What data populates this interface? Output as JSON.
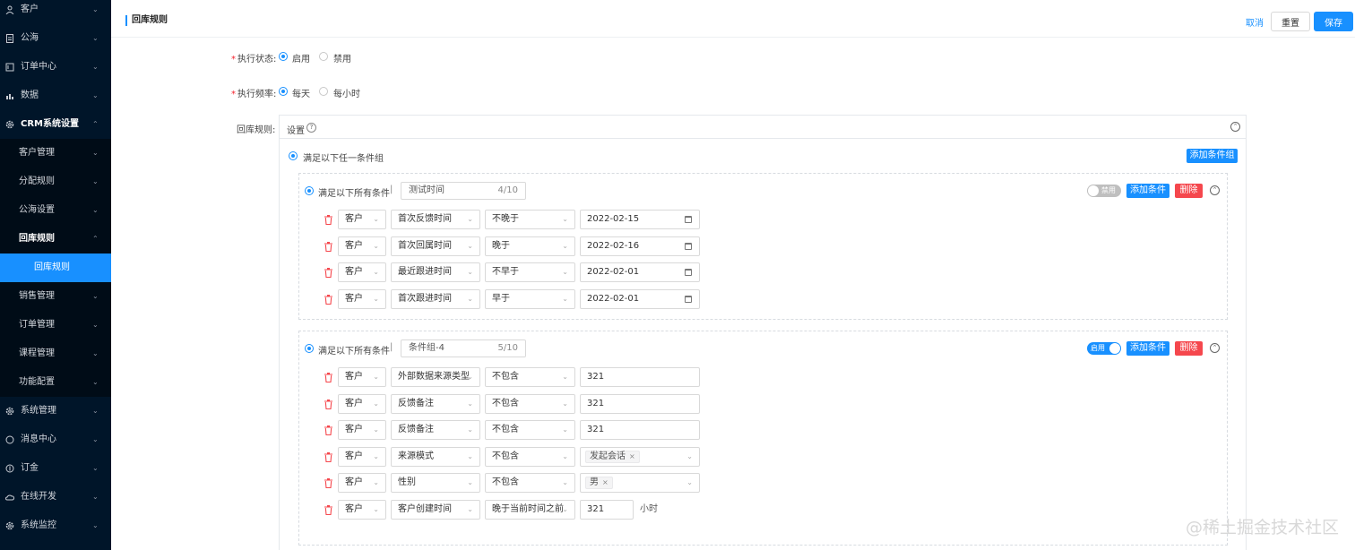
{
  "sidebar": {
    "items": [
      {
        "label": "客户",
        "icon": "user-icon",
        "chevron": "⌄",
        "type": "top"
      },
      {
        "label": "公海",
        "icon": "document-icon",
        "chevron": "⌄",
        "type": "top"
      },
      {
        "label": "订单中心",
        "icon": "receipt-icon",
        "chevron": "⌄",
        "type": "top"
      },
      {
        "label": "数据",
        "icon": "bar-chart-icon",
        "chevron": "⌄",
        "type": "top"
      },
      {
        "label": "CRM系统设置",
        "icon": "gear-icon",
        "chevron": "⌃",
        "type": "top-open"
      },
      {
        "label": "客户管理",
        "chevron": "⌄",
        "type": "sub"
      },
      {
        "label": "分配规则",
        "chevron": "⌄",
        "type": "sub"
      },
      {
        "label": "公海设置",
        "chevron": "⌄",
        "type": "sub"
      },
      {
        "label": "回库规则",
        "chevron": "⌃",
        "type": "sub-open"
      },
      {
        "label": "回库规则",
        "chevron": "",
        "type": "active"
      },
      {
        "label": "销售管理",
        "chevron": "⌄",
        "type": "sub"
      },
      {
        "label": "订单管理",
        "chevron": "⌄",
        "type": "sub"
      },
      {
        "label": "课程管理",
        "chevron": "⌄",
        "type": "sub"
      },
      {
        "label": "功能配置",
        "chevron": "⌄",
        "type": "sub"
      },
      {
        "label": "系统管理",
        "icon": "gear-icon",
        "chevron": "⌄",
        "type": "top"
      },
      {
        "label": "消息中心",
        "icon": "message-icon",
        "chevron": "⌄",
        "type": "top"
      },
      {
        "label": "订金",
        "icon": "coin-icon",
        "chevron": "⌄",
        "type": "top"
      },
      {
        "label": "在线开发",
        "icon": "cloud-icon",
        "chevron": "⌄",
        "type": "top"
      },
      {
        "label": "系统监控",
        "icon": "gear-icon",
        "chevron": "⌄",
        "type": "top"
      }
    ]
  },
  "header": {
    "title": "回库规则",
    "cancel": "取消",
    "reset": "重置",
    "save": "保存"
  },
  "form": {
    "status_label": "执行状态:",
    "status_options": [
      "启用",
      "禁用"
    ],
    "status_selected": "启用",
    "freq_label": "执行频率:",
    "freq_options": [
      "每天",
      "每小时"
    ],
    "freq_selected": "每天",
    "rule_label": "回库规则:",
    "settings_label": "设置",
    "help_icon": "?",
    "collapse_icon": "⌃",
    "any_group_label": "满足以下任一条件组",
    "add_group_button": "添加条件组"
  },
  "groups": [
    {
      "match_label": "满足以下所有条件",
      "separator": "|",
      "name": "测试时间",
      "count": "4/10",
      "toggle_text": "禁用",
      "enabled": false,
      "add_condition": "添加条件",
      "delete": "删除",
      "conditions": [
        {
          "object": "客户",
          "field": "首次反馈时间",
          "operator": "不晚于",
          "value": "2022-02-15",
          "value_type": "date"
        },
        {
          "object": "客户",
          "field": "首次回属时间",
          "operator": "晚于",
          "value": "2022-02-16",
          "value_type": "date"
        },
        {
          "object": "客户",
          "field": "最近跟进时间",
          "operator": "不早于",
          "value": "2022-02-01",
          "value_type": "date"
        },
        {
          "object": "客户",
          "field": "首次跟进时间",
          "operator": "早于",
          "value": "2022-02-01",
          "value_type": "date"
        }
      ]
    },
    {
      "match_label": "满足以下所有条件",
      "separator": "|",
      "name": "条件组-4",
      "count": "5/10",
      "toggle_text": "启用",
      "enabled": true,
      "add_condition": "添加条件",
      "delete": "删除",
      "conditions": [
        {
          "object": "客户",
          "field": "外部数据来源类型",
          "operator": "不包含",
          "value": "321",
          "value_type": "text"
        },
        {
          "object": "客户",
          "field": "反馈备注",
          "operator": "不包含",
          "value": "321",
          "value_type": "text"
        },
        {
          "object": "客户",
          "field": "反馈备注",
          "operator": "不包含",
          "value": "321",
          "value_type": "text"
        },
        {
          "object": "客户",
          "field": "来源模式",
          "operator": "不包含",
          "value": "发起会话",
          "value_type": "tag"
        },
        {
          "object": "客户",
          "field": "性别",
          "operator": "不包含",
          "value": "男",
          "value_type": "tag"
        },
        {
          "object": "客户",
          "field": "客户创建时间",
          "operator": "晚于当前时间之前",
          "value": "321",
          "value_type": "number",
          "unit": "小时"
        }
      ]
    }
  ],
  "watermark": "@稀土掘金技术社区",
  "colors": {
    "sidebar_bg": "#001529",
    "accent": "#1890ff",
    "danger": "#f5474d"
  }
}
